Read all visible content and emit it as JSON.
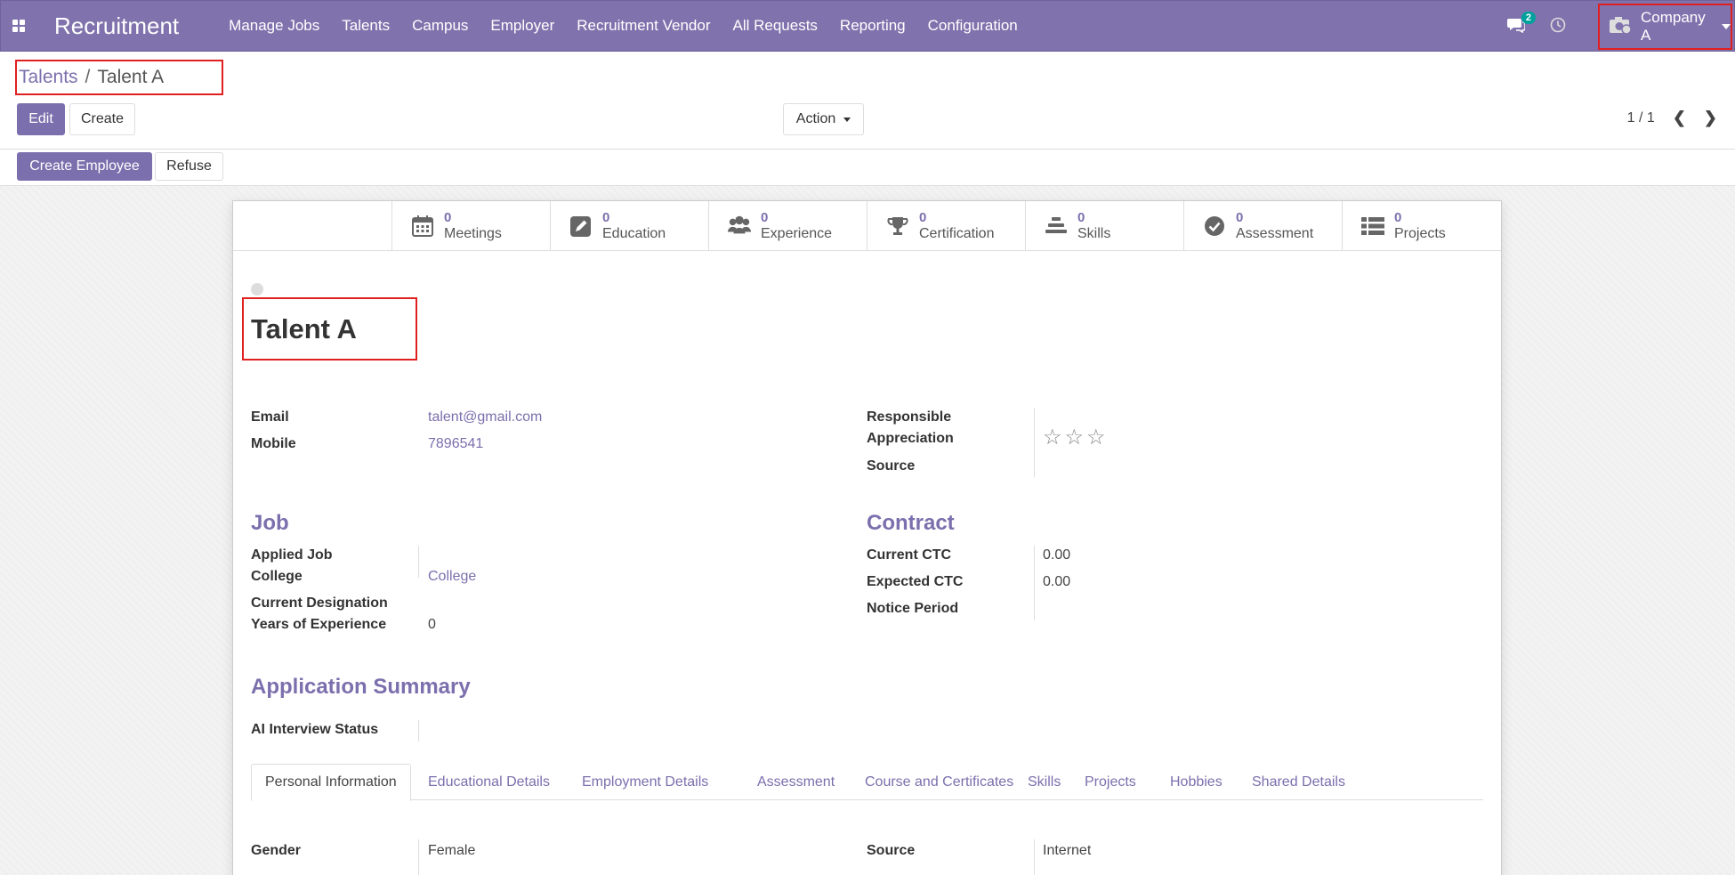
{
  "navbar": {
    "app_title": "Recruitment",
    "menu": [
      "Manage Jobs",
      "Talents",
      "Campus",
      "Employer",
      "Recruitment Vendor",
      "All Requests",
      "Reporting",
      "Configuration"
    ],
    "chat_count": "2",
    "company": "Company A"
  },
  "control": {
    "breadcrumb_parent": "Talents",
    "breadcrumb_separator": "/",
    "breadcrumb_current": "Talent A",
    "edit_label": "Edit",
    "create_label": "Create",
    "action_label": "Action",
    "pager": "1 / 1"
  },
  "statusbar": {
    "create_employee_label": "Create Employee",
    "refuse_label": "Refuse"
  },
  "smart_buttons": [
    {
      "count": "0",
      "label": "Meetings",
      "icon": "calendar-icon"
    },
    {
      "count": "0",
      "label": "Education",
      "icon": "edit-icon"
    },
    {
      "count": "0",
      "label": "Experience",
      "icon": "users-icon"
    },
    {
      "count": "0",
      "label": "Certification",
      "icon": "trophy-icon"
    },
    {
      "count": "0",
      "label": "Skills",
      "icon": "skills-icon"
    },
    {
      "count": "0",
      "label": "Assessment",
      "icon": "check-circle-icon"
    },
    {
      "count": "0",
      "label": "Projects",
      "icon": "list-icon"
    }
  ],
  "record": {
    "name": "Talent A",
    "email_label": "Email",
    "email": "talent@gmail.com",
    "mobile_label": "Mobile",
    "mobile": "7896541",
    "responsible_label": "Responsible",
    "appreciation_label": "Appreciation",
    "appreciation_stars": "☆☆☆",
    "source_label": "Source"
  },
  "job": {
    "title": "Job",
    "applied_job_label": "Applied Job",
    "college_label": "College",
    "college": "College",
    "current_designation_label": "Current Designation",
    "years_label": "Years of Experience",
    "years": "0"
  },
  "contract": {
    "title": "Contract",
    "current_ctc_label": "Current CTC",
    "current_ctc": "0.00",
    "expected_ctc_label": "Expected CTC",
    "expected_ctc": "0.00",
    "notice_period_label": "Notice Period"
  },
  "summary": {
    "title": "Application Summary",
    "ai_status_label": "AI Interview Status"
  },
  "tabs": [
    "Personal Information",
    "Educational Details",
    "Employment Details",
    "Assessment",
    "Course and Certificates",
    "Skills",
    "Projects",
    "Hobbies",
    "Shared Details"
  ],
  "personal": {
    "gender_label": "Gender",
    "gender": "Female",
    "source_label": "Source",
    "source": "Internet"
  },
  "colors": {
    "brand": "#7c6fad",
    "navbar": "#8073ad",
    "highlight": "#e02020",
    "badge": "#00a09d"
  }
}
